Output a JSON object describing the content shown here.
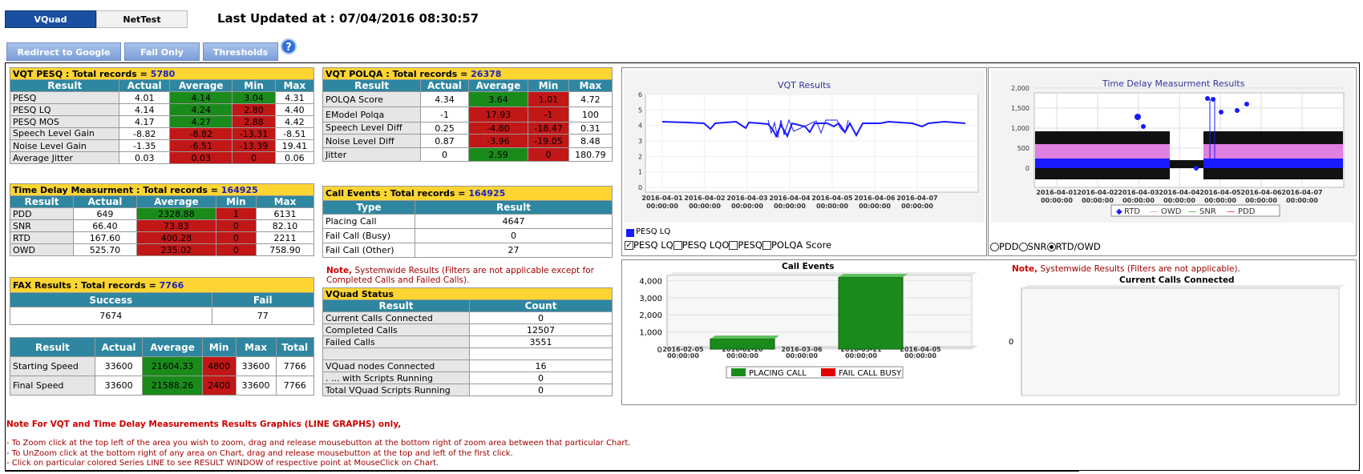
{
  "tabs": {
    "vquad": "VQuad",
    "nettest": "NetTest"
  },
  "last_updated": "Last Updated at : 07/04/2016 08:30:57",
  "buttons": {
    "maps": "Redirect to Google Maps",
    "fail_only": "Fail Only",
    "thresholds": "Thresholds",
    "help": "?"
  },
  "vqt_pesq": {
    "title": "VQT PESQ :",
    "total_label": "Total records =",
    "total": "5780",
    "headers": [
      "Result",
      "Actual",
      "Average",
      "Min",
      "Max"
    ],
    "rows": [
      {
        "name": "PESQ",
        "actual": "4.01",
        "avg": "4.14",
        "min": "3.04",
        "max": "4.31"
      },
      {
        "name": "PESQ LQ",
        "actual": "4.14",
        "avg": "4.24",
        "min": "2.80",
        "max": "4.40"
      },
      {
        "name": "PESQ MOS",
        "actual": "4.17",
        "avg": "4.27",
        "min": "2.88",
        "max": "4.42"
      },
      {
        "name": "Speech Level Gain",
        "actual": "-8.82",
        "avg": "-8.82",
        "min": "-13.31",
        "max": "-8.51"
      },
      {
        "name": "Noise Level Gain",
        "actual": "-1.35",
        "avg": "-6.51",
        "min": "-13.39",
        "max": "19.41"
      },
      {
        "name": "Average Jitter",
        "actual": "0.03",
        "avg": "0.03",
        "min": "0",
        "max": "0.06"
      }
    ]
  },
  "time_delay": {
    "title": "Time Delay Measurment :",
    "total_label": "Total records =",
    "total": "164925",
    "headers": [
      "Result",
      "Actual",
      "Average",
      "Min",
      "Max"
    ],
    "rows": [
      {
        "name": "PDD",
        "actual": "649",
        "avg": "2328.88",
        "min": "1",
        "max": "6131"
      },
      {
        "name": "SNR",
        "actual": "66.40",
        "avg": "73.83",
        "min": "0",
        "max": "82.10"
      },
      {
        "name": "RTD",
        "actual": "167.60",
        "avg": "400.28",
        "min": "0",
        "max": "2211"
      },
      {
        "name": "OWD",
        "actual": "525.70",
        "avg": "235.02",
        "min": "0",
        "max": "758.90"
      }
    ]
  },
  "fax": {
    "title": "FAX Results :",
    "total_label": "Total records =",
    "total": "7766",
    "headers": [
      "Success",
      "Fail"
    ],
    "success": "7674",
    "fail": "77"
  },
  "speed": {
    "headers": [
      "Result",
      "Actual",
      "Average",
      "Min",
      "Max",
      "Total"
    ],
    "rows": [
      {
        "name": "Starting Speed",
        "actual": "33600",
        "avg": "21604.33",
        "min": "4800",
        "max": "33600",
        "total": "7766"
      },
      {
        "name": "Final Speed",
        "actual": "33600",
        "avg": "21588.26",
        "min": "2400",
        "max": "33600",
        "total": "7766"
      }
    ]
  },
  "vqt_polqa": {
    "title": "VQT POLQA :",
    "total_label": "Total records =",
    "total": "26378",
    "headers": [
      "Result",
      "Actual",
      "Average",
      "Min",
      "Max"
    ],
    "rows": [
      {
        "name": "POLQA Score",
        "actual": "4.34",
        "avg": "3.64",
        "min": "1.01",
        "max": "4.72"
      },
      {
        "name": "EModel Polqa",
        "actual": "-1",
        "avg": "17.93",
        "min": "-1",
        "max": "100"
      },
      {
        "name": "Speech Level Diff",
        "actual": "0.25",
        "avg": "-4.80",
        "min": "-18.47",
        "max": "0.31"
      },
      {
        "name": "Noise Level Diff",
        "actual": "0.87",
        "avg": "-3.96",
        "min": "-19.05",
        "max": "8.48"
      },
      {
        "name": "Jitter",
        "actual": "0",
        "avg": "2.59",
        "min": "0",
        "max": "180.79"
      }
    ]
  },
  "call_events": {
    "title": "Call Events :",
    "total_label": "Total records =",
    "total": "164925",
    "headers": [
      "Type",
      "Result"
    ],
    "rows": [
      {
        "type": "Placing Call",
        "result": "4647"
      },
      {
        "type": "Fail Call (Busy)",
        "result": "0"
      },
      {
        "type": "Fail Call (Other)",
        "result": "27"
      }
    ]
  },
  "note1": {
    "prefix": "Note,",
    "text": " Systemwide Results (Filters are not applicable except for Completed Calls and Failed Calls)."
  },
  "vquad_status": {
    "title": "VQuad Status",
    "headers": [
      "Result",
      "Count"
    ],
    "rows": [
      {
        "name": "Current Calls Connected",
        "count": "0"
      },
      {
        "name": "Completed Calls",
        "count": "12507"
      },
      {
        "name": "Failed Calls",
        "count": "3551"
      },
      {
        "name": "",
        "count": ""
      },
      {
        "name": "VQuad nodes Connected",
        "count": "16"
      },
      {
        "name": ". ... with Scripts Running",
        "count": "0"
      },
      {
        "name": "Total VQuad Scripts Running",
        "count": "0"
      }
    ]
  },
  "vqt_chart": {
    "title": "VQT  Results",
    "yticks": [
      "0",
      "1",
      "2",
      "3",
      "4",
      "5",
      "6"
    ],
    "xticks": [
      [
        "2016-04-01",
        "00:00:00"
      ],
      [
        "2016-04-02",
        "00:00:00"
      ],
      [
        "2016-04-03",
        "00:00:00"
      ],
      [
        "2016-04-04",
        "00:00:00"
      ],
      [
        "2016-04-05",
        "00:00:00"
      ],
      [
        "2016-04-06",
        "00:00:00"
      ],
      [
        "2016-04-07",
        "00:00:00"
      ]
    ],
    "legend": "PESQ LQ",
    "checks": [
      {
        "label": "PESQ LQ",
        "checked": true
      },
      {
        "label": "PESQ LQO",
        "checked": false
      },
      {
        "label": "PESQ",
        "checked": false
      },
      {
        "label": "POLQA Score",
        "checked": false
      }
    ],
    "series_color": "#1a1aff"
  },
  "td_chart": {
    "title": "Time Delay Measurment Results",
    "yticks": [
      "0",
      "500",
      "1,000",
      "1,500",
      "2,000"
    ],
    "xticks": [
      [
        "2016-04-01",
        "00:00:00"
      ],
      [
        "2016-04-02",
        "00:00:00"
      ],
      [
        "2016-04-03",
        "00:00:00"
      ],
      [
        "2016-04-04",
        "00:00:00"
      ],
      [
        "2016-04-05",
        "00:00:00"
      ],
      [
        "2016-04-06",
        "00:00:00"
      ],
      [
        "2016-04-07",
        "00:00:00"
      ]
    ],
    "legend": [
      "RTD",
      "OWD",
      "SNR",
      "PDD"
    ],
    "radios": [
      {
        "label": "PDD",
        "checked": false
      },
      {
        "label": "SNR",
        "checked": false
      },
      {
        "label": "RTD/OWD",
        "checked": true
      }
    ]
  },
  "chart_data": [
    {
      "type": "bar",
      "title": "Call Events",
      "categories": [
        "2016-02-05 00:00:00",
        "2016-02-20 00:00:00",
        "2016-03-06 00:00:00",
        "2016-03-21 00:00:00",
        "2016-04-05 00:00:00"
      ],
      "series": [
        {
          "name": "PLACING CALL",
          "color": "#1a8b1a",
          "values": [
            0,
            600,
            0,
            4200,
            0
          ]
        },
        {
          "name": "FAIL CALL BUSY",
          "color": "#e00000",
          "values": [
            0,
            0,
            0,
            0,
            0
          ]
        }
      ],
      "yticks": [
        "0",
        "1,000",
        "2,000",
        "3,000",
        "4,000"
      ],
      "ylim": [
        0,
        4300
      ],
      "xtick_labels": [
        [
          "2016-02-05",
          "00:00:00"
        ],
        [
          "2016-02-20",
          "00:00:00"
        ],
        [
          "2016-03-06",
          "00:00:00"
        ],
        [
          "2016-03-21",
          "00:00:00"
        ],
        [
          "2016-04-05",
          "00:00:00"
        ]
      ]
    },
    {
      "type": "bar",
      "title": "Current Calls Connected",
      "categories": [],
      "values": [
        0
      ],
      "yticks": [
        "0"
      ]
    }
  ],
  "note2": {
    "prefix": "Note,",
    "text": " Systemwide Results (Filters are not applicable)."
  },
  "footer": {
    "title": "Note For VQT and Time Delay Measurements Results Graphics (LINE GRAPHS) only,",
    "lines": [
      "- To Zoom click at the top left of the area you wish to zoom, drag and release mousebutton at the bottom right of zoom area between that particular Chart.",
      "- To UnZoom click at the bottom right of any area on Chart, drag and release mousebutton at the top and left of the first click.",
      "- Click on particular colored Series LINE to see RESULT WINDOW of respective point at MouseClick on Chart."
    ]
  }
}
